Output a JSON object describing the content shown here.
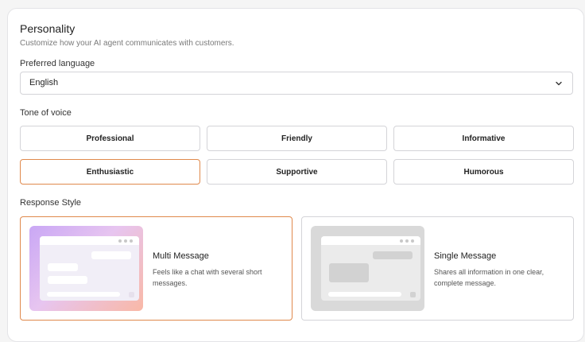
{
  "personality": {
    "title": "Personality",
    "subtitle": "Customize how your AI agent communicates with customers."
  },
  "language": {
    "label": "Preferred language",
    "value": "English",
    "icon": "chevron-down-icon"
  },
  "tone": {
    "label": "Tone of voice",
    "selected": "Enthusiastic",
    "options": [
      "Professional",
      "Friendly",
      "Informative",
      "Enthusiastic",
      "Supportive",
      "Humorous"
    ]
  },
  "response_style": {
    "label": "Response Style",
    "selected": "Multi Message",
    "options": [
      {
        "title": "Multi Message",
        "description": "Feels like a chat with several short messages."
      },
      {
        "title": "Single Message",
        "description": "Shares all information in one clear, complete message."
      }
    ]
  },
  "colors": {
    "accent": "#e0894c",
    "border": "#d4d4d8"
  }
}
